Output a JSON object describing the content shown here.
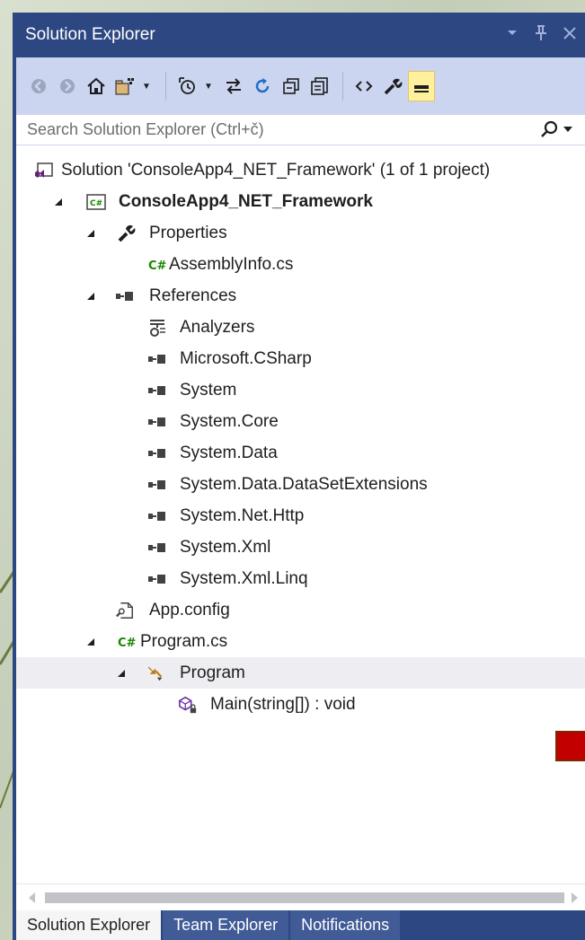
{
  "window": {
    "title": "Solution Explorer",
    "controls": [
      "dropdown",
      "pin",
      "close"
    ]
  },
  "toolbar": {
    "buttons": [
      "back-icon",
      "forward-icon",
      "home-icon",
      "switch-views-icon",
      "pending-changes-filter-icon",
      "sync-with-document-icon",
      "refresh-icon",
      "collapse-all-icon",
      "show-all-files-icon",
      "view-code-icon",
      "properties-icon",
      "preview-selected-items-icon"
    ]
  },
  "search": {
    "placeholder": "Search Solution Explorer (Ctrl+č)"
  },
  "tree": {
    "solution": "Solution 'ConsoleApp4_NET_Framework' (1 of 1 project)",
    "project": "ConsoleApp4_NET_Framework",
    "properties": "Properties",
    "assembly_info": "AssemblyInfo.cs",
    "references": "References",
    "reference_items": [
      "Analyzers",
      "Microsoft.CSharp",
      "System",
      "System.Core",
      "System.Data",
      "System.Data.DataSetExtensions",
      "System.Net.Http",
      "System.Xml",
      "System.Xml.Linq"
    ],
    "app_config": "App.config",
    "program_cs": "Program.cs",
    "program_class": "Program",
    "main_method": "Main(string[]) : void"
  },
  "tabs": [
    "Solution Explorer",
    "Team Explorer",
    "Notifications"
  ],
  "colors": {
    "frame": "#2d4782",
    "toolbar": "#ccd5f0",
    "selection": "#eeeef2",
    "active_button": "#fff09e",
    "csharp_green": "#178600"
  }
}
